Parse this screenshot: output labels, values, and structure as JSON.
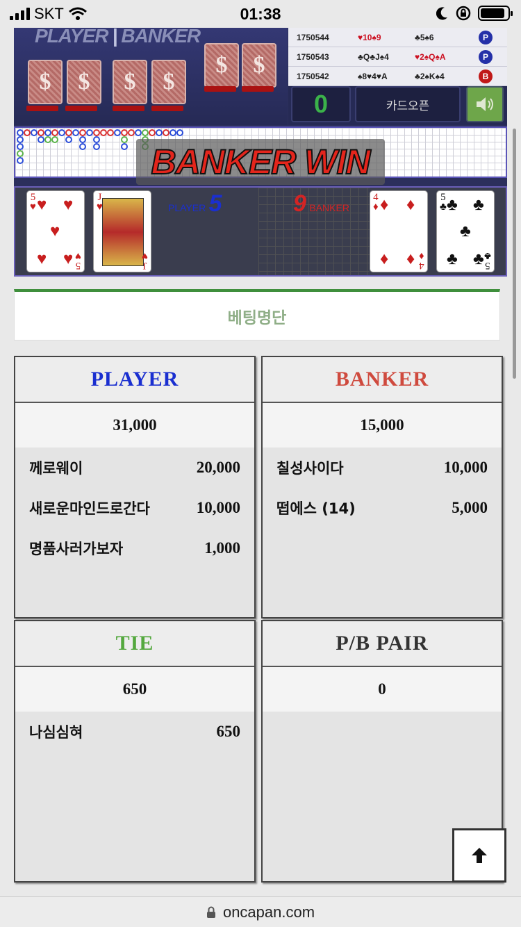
{
  "status_bar": {
    "carrier": "SKT",
    "time": "01:38"
  },
  "game": {
    "header_player": "PLAYER",
    "header_banker": "BANKER",
    "history": [
      {
        "round": "1750544",
        "player": "♥10♠9",
        "banker": "♣5♠6",
        "result": "P",
        "result_color": "#2430a8"
      },
      {
        "round": "1750543",
        "player": "♣Q♣J♠4",
        "banker": "♥2♠Q♠A",
        "result": "P",
        "result_color": "#2430a8"
      },
      {
        "round": "1750542",
        "player": "♠8♥4♥A",
        "banker": "♣2♠K♠4",
        "result": "B",
        "result_color": "#c01818"
      }
    ],
    "counter": "0",
    "card_open_label": "카드오픈",
    "banner": "BANKER WIN",
    "player_label": "PLAYER",
    "player_score": "5",
    "banker_label": "BANKER",
    "banker_score": "9"
  },
  "betting": {
    "title": "베팅명단",
    "player": {
      "title": "PLAYER",
      "color": "#1a2fd0",
      "total": "31,000",
      "entries": [
        {
          "name": "께로웨이",
          "amount": "20,000"
        },
        {
          "name": "새로운마인드로간다",
          "amount": "10,000"
        },
        {
          "name": "명품사러가보자",
          "amount": "1,000"
        }
      ]
    },
    "banker": {
      "title": "BANKER",
      "color": "#cf4a3e",
      "total": "15,000",
      "entries": [
        {
          "name": "칠성사이다",
          "amount": "10,000"
        },
        {
          "name": "떱에스 (14)",
          "amount": "5,000"
        }
      ]
    },
    "tie": {
      "title": "TIE",
      "color": "#54a83e",
      "total": "650",
      "entries": [
        {
          "name": "나심심혀",
          "amount": "650"
        }
      ]
    },
    "pair": {
      "title": "P/B PAIR",
      "color": "#333333",
      "total": "0",
      "entries": []
    }
  },
  "browser": {
    "url": "oncapan.com"
  }
}
